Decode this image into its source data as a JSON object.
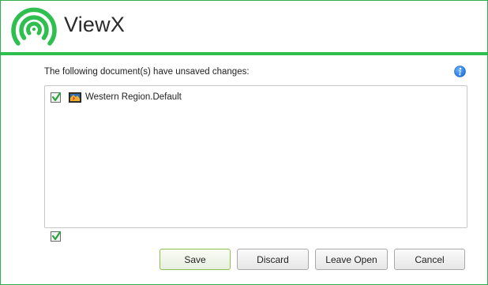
{
  "app": {
    "title": "ViewX",
    "logo_icon": "wireless-signal-icon",
    "accent_color": "#2fbf4f"
  },
  "dialog": {
    "prompt": "The following document(s) have unsaved changes:",
    "info_icon": "info-icon",
    "documents": [
      {
        "name": "Western Region.Default",
        "checked": true,
        "icon": "map-document-icon"
      }
    ],
    "select_all_checked": true
  },
  "buttons": {
    "save": {
      "first": "S",
      "rest": "ave"
    },
    "discard": {
      "first": "D",
      "rest": "iscard"
    },
    "leave_open": {
      "first": "L",
      "rest": "eave Open"
    },
    "cancel": {
      "first": "C",
      "rest": "ancel"
    }
  }
}
